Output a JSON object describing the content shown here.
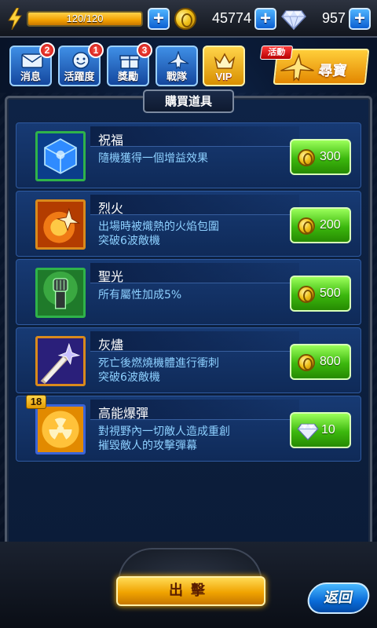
{
  "status": {
    "energy_text": "120/120",
    "energy_fraction": 1.0,
    "coins": "45774",
    "gems": "957"
  },
  "menu": {
    "messages": {
      "label": "消息",
      "badge": "2"
    },
    "activity": {
      "label": "活躍度",
      "badge": "1"
    },
    "rewards": {
      "label": "獎勵",
      "badge": "3"
    },
    "squad": {
      "label": "戰隊"
    },
    "vip": {
      "label": "VIP"
    },
    "treasure": {
      "label": "尋寶",
      "tag": "活動"
    }
  },
  "panel": {
    "title": "購買道具"
  },
  "items": [
    {
      "name": "祝福",
      "desc": "隨機獲得一個增益效果",
      "price": "300",
      "currency": "coin",
      "icon": "cube-icon"
    },
    {
      "name": "烈火",
      "desc": "出場時被熾熱的火焰包圍\n突破6波敵機",
      "price": "200",
      "currency": "coin",
      "icon": "flame-jet-icon"
    },
    {
      "name": "聖光",
      "desc": "所有屬性加成5%",
      "price": "500",
      "currency": "coin",
      "icon": "fist-icon"
    },
    {
      "name": "灰燼",
      "desc": "死亡後燃燒機體進行衝刺\n突破6波敵機",
      "price": "800",
      "currency": "coin",
      "icon": "dash-jet-icon"
    },
    {
      "name": "高能爆彈",
      "desc": "對視野內一切敵人造成重創\n摧毀敵人的攻擊彈幕",
      "price": "10",
      "currency": "gem",
      "icon": "radiation-icon",
      "level": "18"
    }
  ],
  "bottom": {
    "sortie_label": "出擊",
    "back_label": "返回"
  },
  "colors": {
    "accent_blue": "#1b6fd9",
    "buy_green": "#3cb80e",
    "gold": "#f0a300"
  }
}
